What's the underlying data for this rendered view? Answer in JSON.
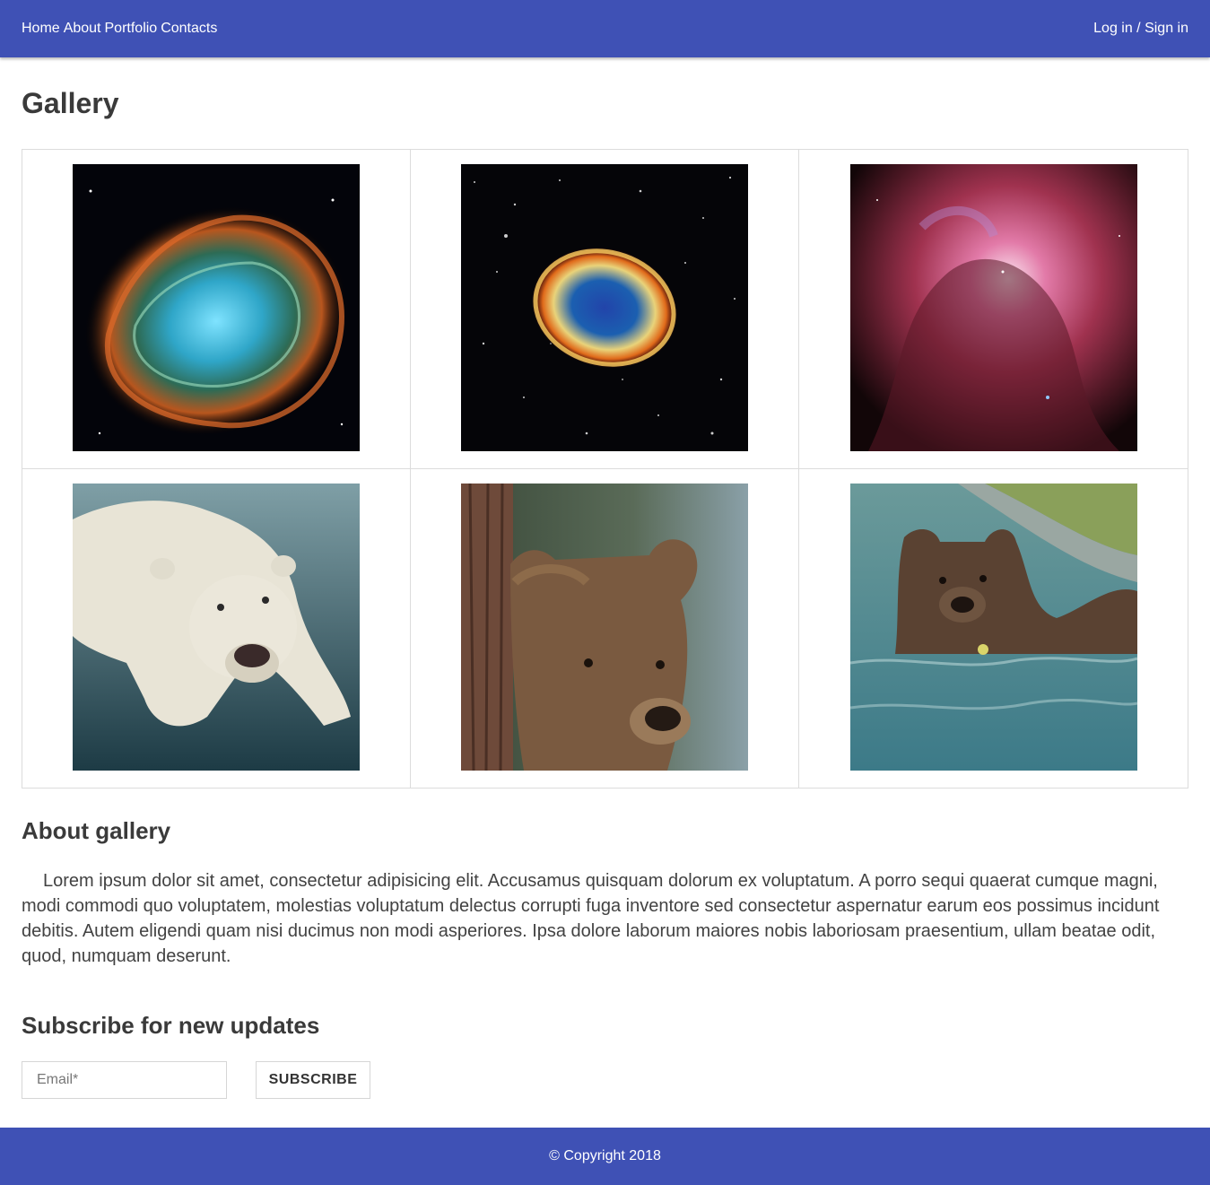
{
  "navbar": {
    "links": [
      {
        "label": "Home"
      },
      {
        "label": "About"
      },
      {
        "label": "Portfolio"
      },
      {
        "label": "Contacts"
      }
    ],
    "auth_label": "Log in / Sign in",
    "background": "#3f51b5"
  },
  "page": {
    "title": "Gallery"
  },
  "gallery": {
    "images": [
      {
        "subject": "crab-nebula"
      },
      {
        "subject": "supernova-remnant"
      },
      {
        "subject": "orion-nebula"
      },
      {
        "subject": "polar-bear-swimming"
      },
      {
        "subject": "brown-bear-by-tree"
      },
      {
        "subject": "brown-bear-in-water"
      }
    ]
  },
  "about": {
    "title": "About gallery",
    "text": "Lorem ipsum dolor sit amet, consectetur adipisicing elit. Accusamus quisquam dolorum ex voluptatum. A porro sequi quaerat cumque magni, modi commodi quo voluptatem, molestias voluptatum delectus corrupti fuga inventore sed consectetur aspernatur earum eos possimus incidunt debitis. Autem eligendi quam nisi ducimus non modi asperiores. Ipsa dolore laborum maiores nobis laboriosam praesentium, ullam beatae odit, quod, numquam deserunt."
  },
  "subscribe": {
    "title": "Subscribe for new updates",
    "email_placeholder": "Email*",
    "email_value": "",
    "button_label": "SUBSCRIBE"
  },
  "footer": {
    "copyright": "© Copyright 2018"
  }
}
